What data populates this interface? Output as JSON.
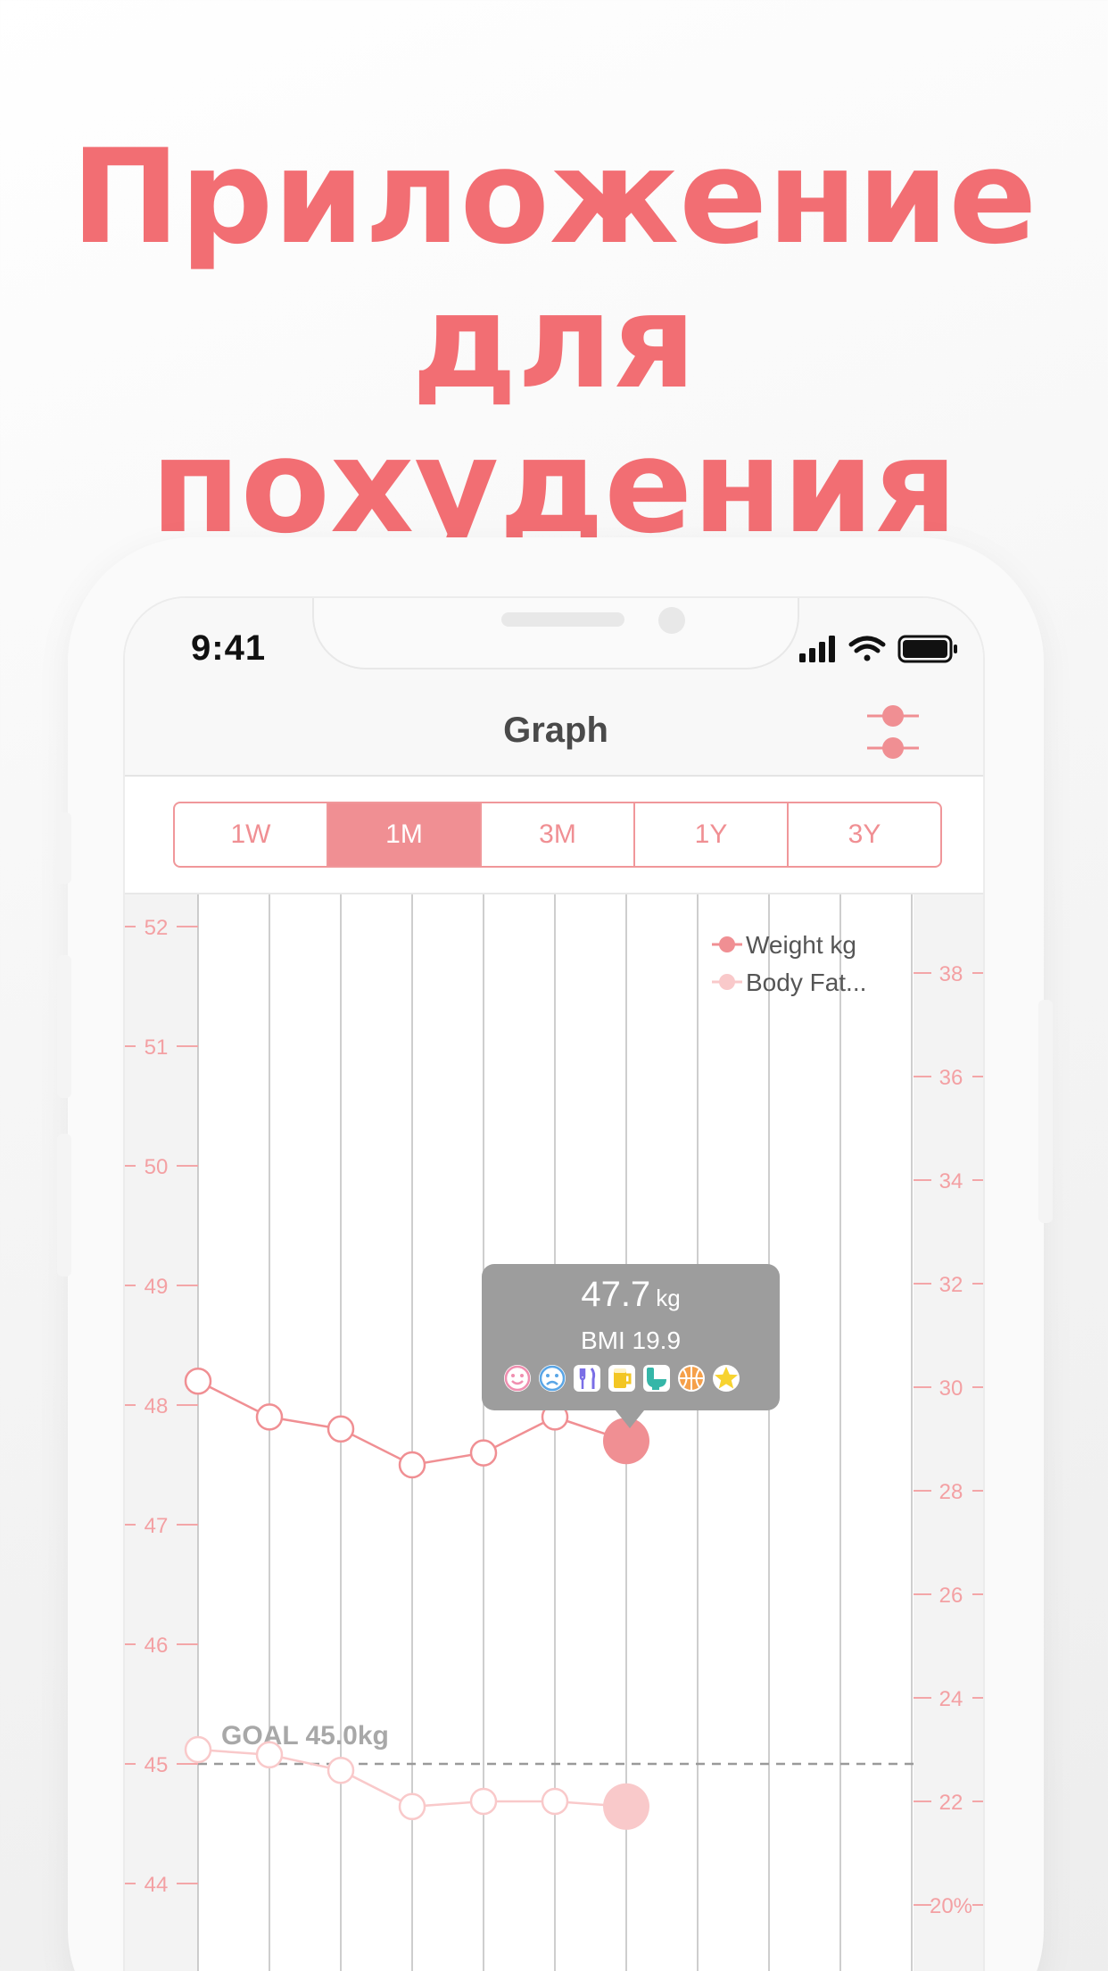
{
  "headline": {
    "line1": "Приложение",
    "line2": "для похудения",
    "color": "#f26e73"
  },
  "statusbar": {
    "time": "9:41",
    "icons": [
      "signal-icon",
      "wifi-icon",
      "battery-icon"
    ]
  },
  "navbar": {
    "title": "Graph",
    "filter_icon": "filter-sliders-icon"
  },
  "segments": [
    {
      "label": "1W",
      "active": false
    },
    {
      "label": "1M",
      "active": true
    },
    {
      "label": "3M",
      "active": false
    },
    {
      "label": "1Y",
      "active": false
    },
    {
      "label": "3Y",
      "active": false
    }
  ],
  "legend": [
    {
      "label": "Weight kg",
      "color": "#f08f93"
    },
    {
      "label": "Body Fat...",
      "color": "#f9c9ca"
    }
  ],
  "goal": {
    "label": "GOAL 45.0kg",
    "value": 45.0
  },
  "tooltip": {
    "weight": "47.7",
    "unit": "kg",
    "bmi": "BMI 19.9",
    "icons": [
      "smile-icon",
      "sad-icon",
      "fork-knife-icon",
      "beer-icon",
      "toilet-icon",
      "basketball-icon",
      "star-icon"
    ]
  },
  "chart_data": {
    "type": "line",
    "left_axis": {
      "ticks": [
        "52",
        "51",
        "50",
        "49",
        "48",
        "47",
        "46",
        "45",
        "44"
      ],
      "ylim": [
        44,
        52
      ]
    },
    "right_axis": {
      "ticks": [
        "38",
        "36",
        "34",
        "32",
        "30",
        "28",
        "26",
        "24",
        "22",
        "20%"
      ],
      "ylim": [
        20,
        38
      ]
    },
    "series": [
      {
        "name": "Weight kg",
        "axis": "left",
        "color": "#f08f93",
        "values": [
          48.2,
          47.9,
          47.8,
          47.5,
          47.6,
          47.9,
          47.7
        ]
      },
      {
        "name": "Body Fat...",
        "axis": "right",
        "color": "#f9c9ca",
        "values": [
          23.0,
          22.9,
          22.6,
          21.9,
          22.0,
          22.0,
          21.9
        ]
      }
    ],
    "goal": 45.0,
    "highlight_index": 6
  }
}
